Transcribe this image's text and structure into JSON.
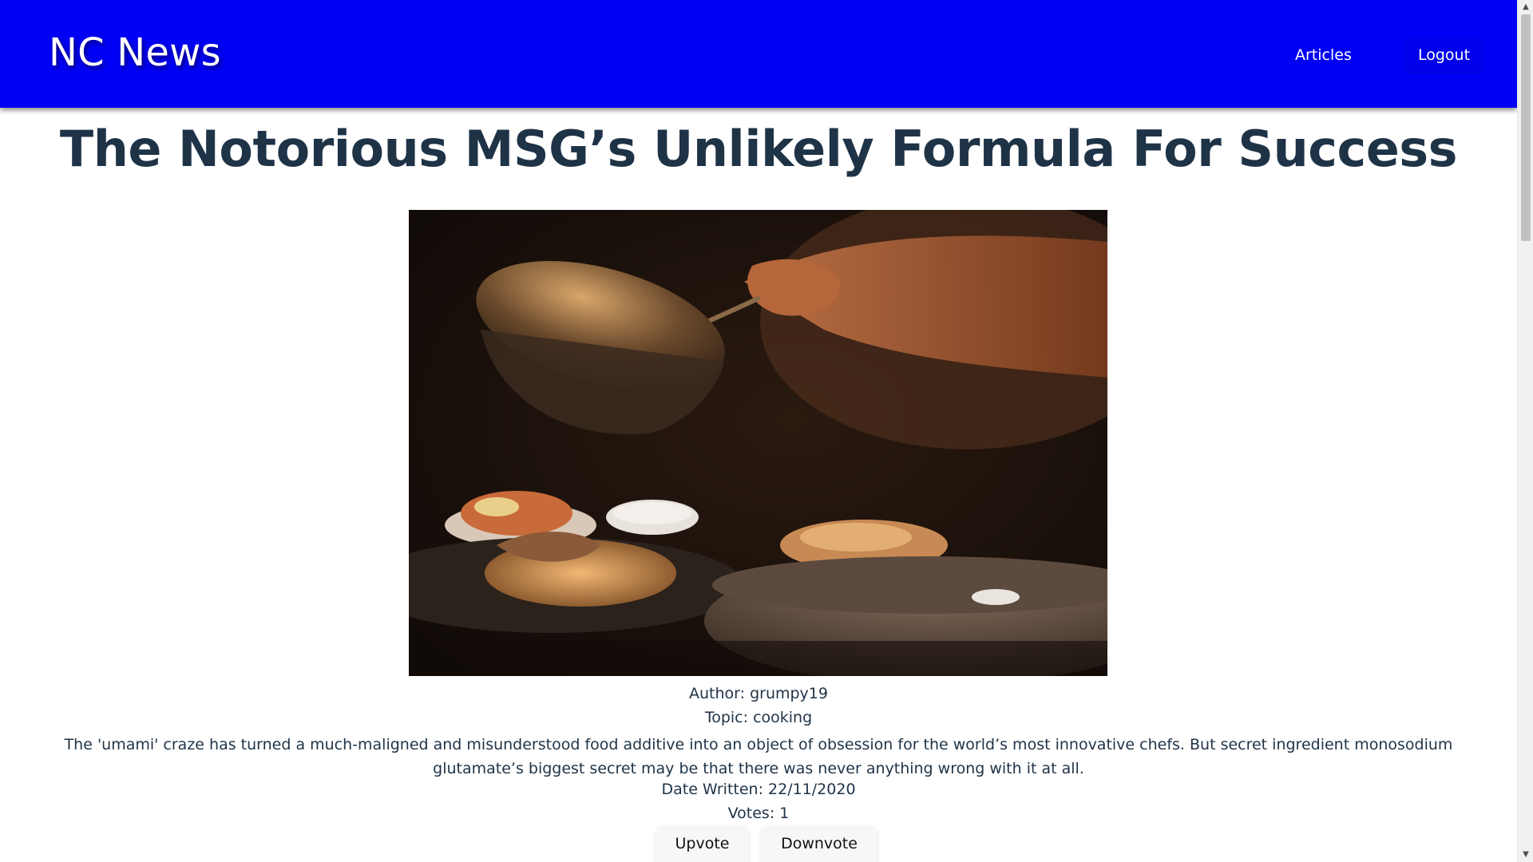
{
  "header": {
    "brand": "NC News",
    "nav": [
      {
        "label": "Articles"
      },
      {
        "label": "Logout"
      }
    ],
    "accent_color": "#0000f5"
  },
  "article": {
    "title": "The Notorious MSG’s Unlikely Formula For Success",
    "image_description_icon": "food-photo",
    "author_line": "Author: grumpy19",
    "topic_line": "Topic: cooking",
    "body": "The 'umami' craze has turned a much-maligned and misunderstood food additive into an object of obsession for the world’s most innovative chefs. But secret ingredient monosodium glutamate’s biggest secret may be that there was never anything wrong with it at all.",
    "date_line": "Date Written: 22/11/2020",
    "votes_line": "Votes: 1",
    "upvote_label": "Upvote",
    "downvote_label": "Downvote"
  },
  "colors": {
    "title_text": "#1f3347",
    "body_text": "#1f3347"
  }
}
